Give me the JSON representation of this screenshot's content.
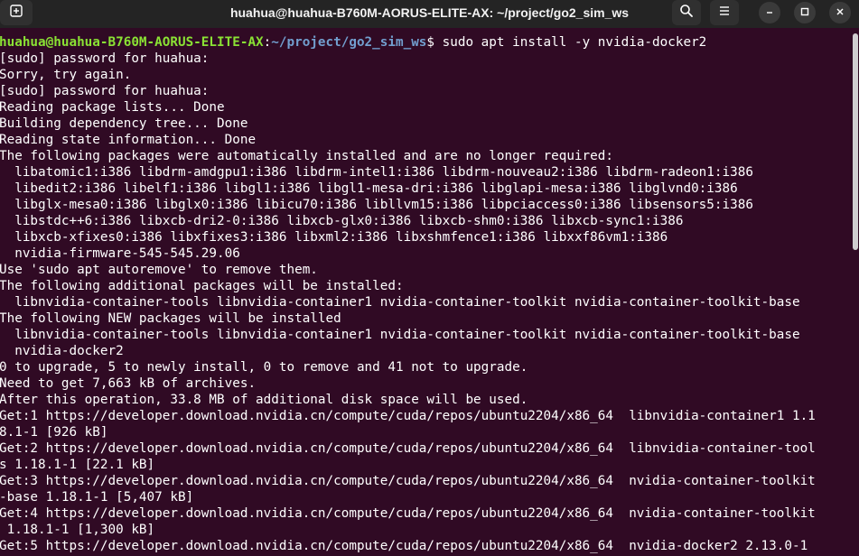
{
  "window": {
    "title": "huahua@huahua-B760M-AORUS-ELITE-AX: ~/project/go2_sim_ws"
  },
  "prompt": {
    "user_host": "huahua@huahua-B760M-AORUS-ELITE-AX",
    "separator": ":",
    "path": "~/project/go2_sim_ws",
    "symbol": "$",
    "command": " sudo apt install -y nvidia-docker2"
  },
  "output_lines": [
    "[sudo] password for huahua:",
    "Sorry, try again.",
    "[sudo] password for huahua:",
    "Reading package lists... Done",
    "Building dependency tree... Done",
    "Reading state information... Done",
    "The following packages were automatically installed and are no longer required:",
    "  libatomic1:i386 libdrm-amdgpu1:i386 libdrm-intel1:i386 libdrm-nouveau2:i386 libdrm-radeon1:i386",
    "  libedit2:i386 libelf1:i386 libgl1:i386 libgl1-mesa-dri:i386 libglapi-mesa:i386 libglvnd0:i386",
    "  libglx-mesa0:i386 libglx0:i386 libicu70:i386 libllvm15:i386 libpciaccess0:i386 libsensors5:i386",
    "  libstdc++6:i386 libxcb-dri2-0:i386 libxcb-glx0:i386 libxcb-shm0:i386 libxcb-sync1:i386",
    "  libxcb-xfixes0:i386 libxfixes3:i386 libxml2:i386 libxshmfence1:i386 libxxf86vm1:i386",
    "  nvidia-firmware-545-545.29.06",
    "Use 'sudo apt autoremove' to remove them.",
    "The following additional packages will be installed:",
    "  libnvidia-container-tools libnvidia-container1 nvidia-container-toolkit nvidia-container-toolkit-base",
    "The following NEW packages will be installed",
    "  libnvidia-container-tools libnvidia-container1 nvidia-container-toolkit nvidia-container-toolkit-base",
    "  nvidia-docker2",
    "0 to upgrade, 5 to newly install, 0 to remove and 41 not to upgrade.",
    "Need to get 7,663 kB of archives.",
    "After this operation, 33.8 MB of additional disk space will be used.",
    "Get:1 https://developer.download.nvidia.cn/compute/cuda/repos/ubuntu2204/x86_64  libnvidia-container1 1.1",
    "8.1-1 [926 kB]",
    "Get:2 https://developer.download.nvidia.cn/compute/cuda/repos/ubuntu2204/x86_64  libnvidia-container-tool",
    "s 1.18.1-1 [22.1 kB]",
    "Get:3 https://developer.download.nvidia.cn/compute/cuda/repos/ubuntu2204/x86_64  nvidia-container-toolkit",
    "-base 1.18.1-1 [5,407 kB]",
    "Get:4 https://developer.download.nvidia.cn/compute/cuda/repos/ubuntu2204/x86_64  nvidia-container-toolkit",
    " 1.18.1-1 [1,300 kB]",
    "Get:5 https://developer.download.nvidia.cn/compute/cuda/repos/ubuntu2204/x86_64  nvidia-docker2 2.13.0-1"
  ],
  "icons": {
    "new_tab": "new-tab-icon",
    "search": "search-icon",
    "menu": "hamburger-menu-icon",
    "minimize": "minimize-icon",
    "maximize": "maximize-icon",
    "close": "close-icon"
  },
  "colors": {
    "terminal_bg": "#300a24",
    "titlebar_bg": "#242424",
    "prompt_user": "#8ae234",
    "prompt_path": "#729fcf",
    "text": "#ffffff"
  }
}
